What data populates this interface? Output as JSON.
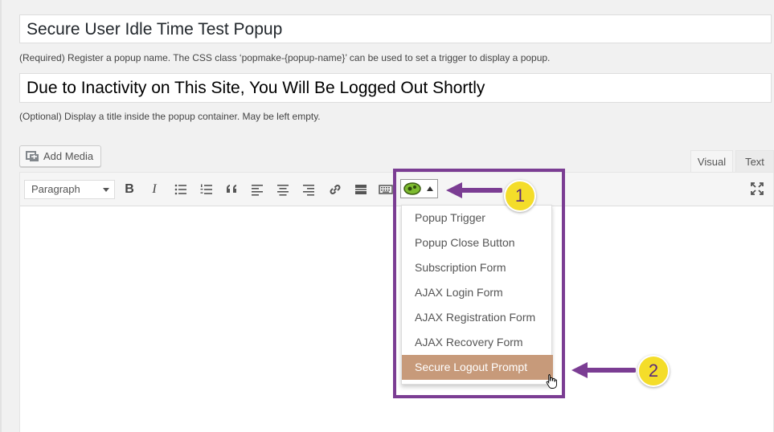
{
  "popup_name": {
    "value": "Secure User Idle Time Test Popup",
    "hint": "(Required) Register a popup name. The CSS class ‘popmake-{popup-name}’ can be used to set a trigger to display a popup."
  },
  "popup_title": {
    "value": "Due to Inactivity on This Site, You Will Be Logged Out Shortly",
    "hint": "(Optional) Display a title inside the popup container. May be left empty."
  },
  "add_media": {
    "label": "Add Media"
  },
  "editor_tabs": {
    "visual": "Visual",
    "text": "Text"
  },
  "toolbar": {
    "format": "Paragraph",
    "buttons": [
      "bold-icon",
      "italic-icon",
      "bullet-list-icon",
      "numbered-list-icon",
      "blockquote-icon",
      "align-left-icon",
      "align-center-icon",
      "align-right-icon",
      "link-icon",
      "read-more-icon",
      "keyboard-icon",
      "popup-maker-icon"
    ],
    "bold": "B",
    "italic": "I"
  },
  "popup_menu": {
    "items": [
      "Popup Trigger",
      "Popup Close Button",
      "Subscription Form",
      "AJAX Login Form",
      "AJAX Registration Form",
      "AJAX Recovery Form",
      "Secure Logout Prompt"
    ],
    "highlighted_index": 6
  },
  "annotations": {
    "step1": "1",
    "step2": "2",
    "highlight_color": "#7b3d93",
    "badge_color": "#f4dd2a"
  }
}
